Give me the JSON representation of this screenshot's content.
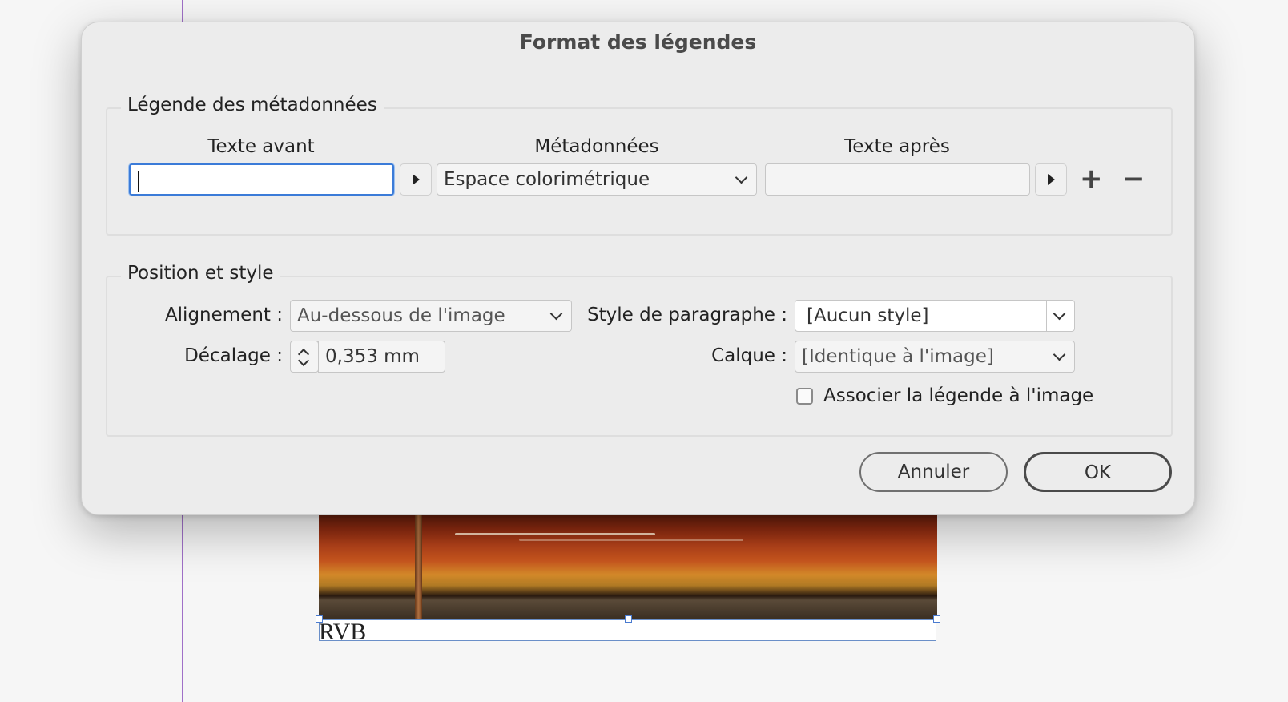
{
  "dialog": {
    "title": "Format des légendes"
  },
  "metadata_group": {
    "legend": "Légende des métadonnées",
    "headers": {
      "text_before": "Texte avant",
      "metadata": "Métadonnées",
      "text_after": "Texte après"
    },
    "text_before_value": "",
    "metadata_selected": "Espace colorimétrique",
    "text_after_value": "",
    "add_symbol": "+",
    "remove_symbol": "−"
  },
  "position_group": {
    "legend": "Position et style",
    "alignment_label": "Alignement :",
    "alignment_value": "Au-dessous de l'image",
    "offset_label": "Décalage :",
    "offset_value": "0,353 mm",
    "paragraph_style_label": "Style de paragraphe :",
    "paragraph_style_value": "[Aucun style]",
    "layer_label": "Calque :",
    "layer_value": "[Identique à l'image]",
    "group_checkbox_label": "Associer la légende à l'image",
    "group_checkbox_checked": false
  },
  "buttons": {
    "cancel": "Annuler",
    "ok": "OK"
  },
  "document": {
    "caption_text": "RVB"
  },
  "icons": {
    "arrow": "triangle-right-icon",
    "dropdown": "chevron-down-icon",
    "stepper": "stepper-icon",
    "add": "plus-icon",
    "remove": "minus-icon"
  },
  "colors": {
    "focus_ring": "#3b7bd8",
    "frame_selection": "#4a7bd0",
    "guide": "#a070c8"
  }
}
